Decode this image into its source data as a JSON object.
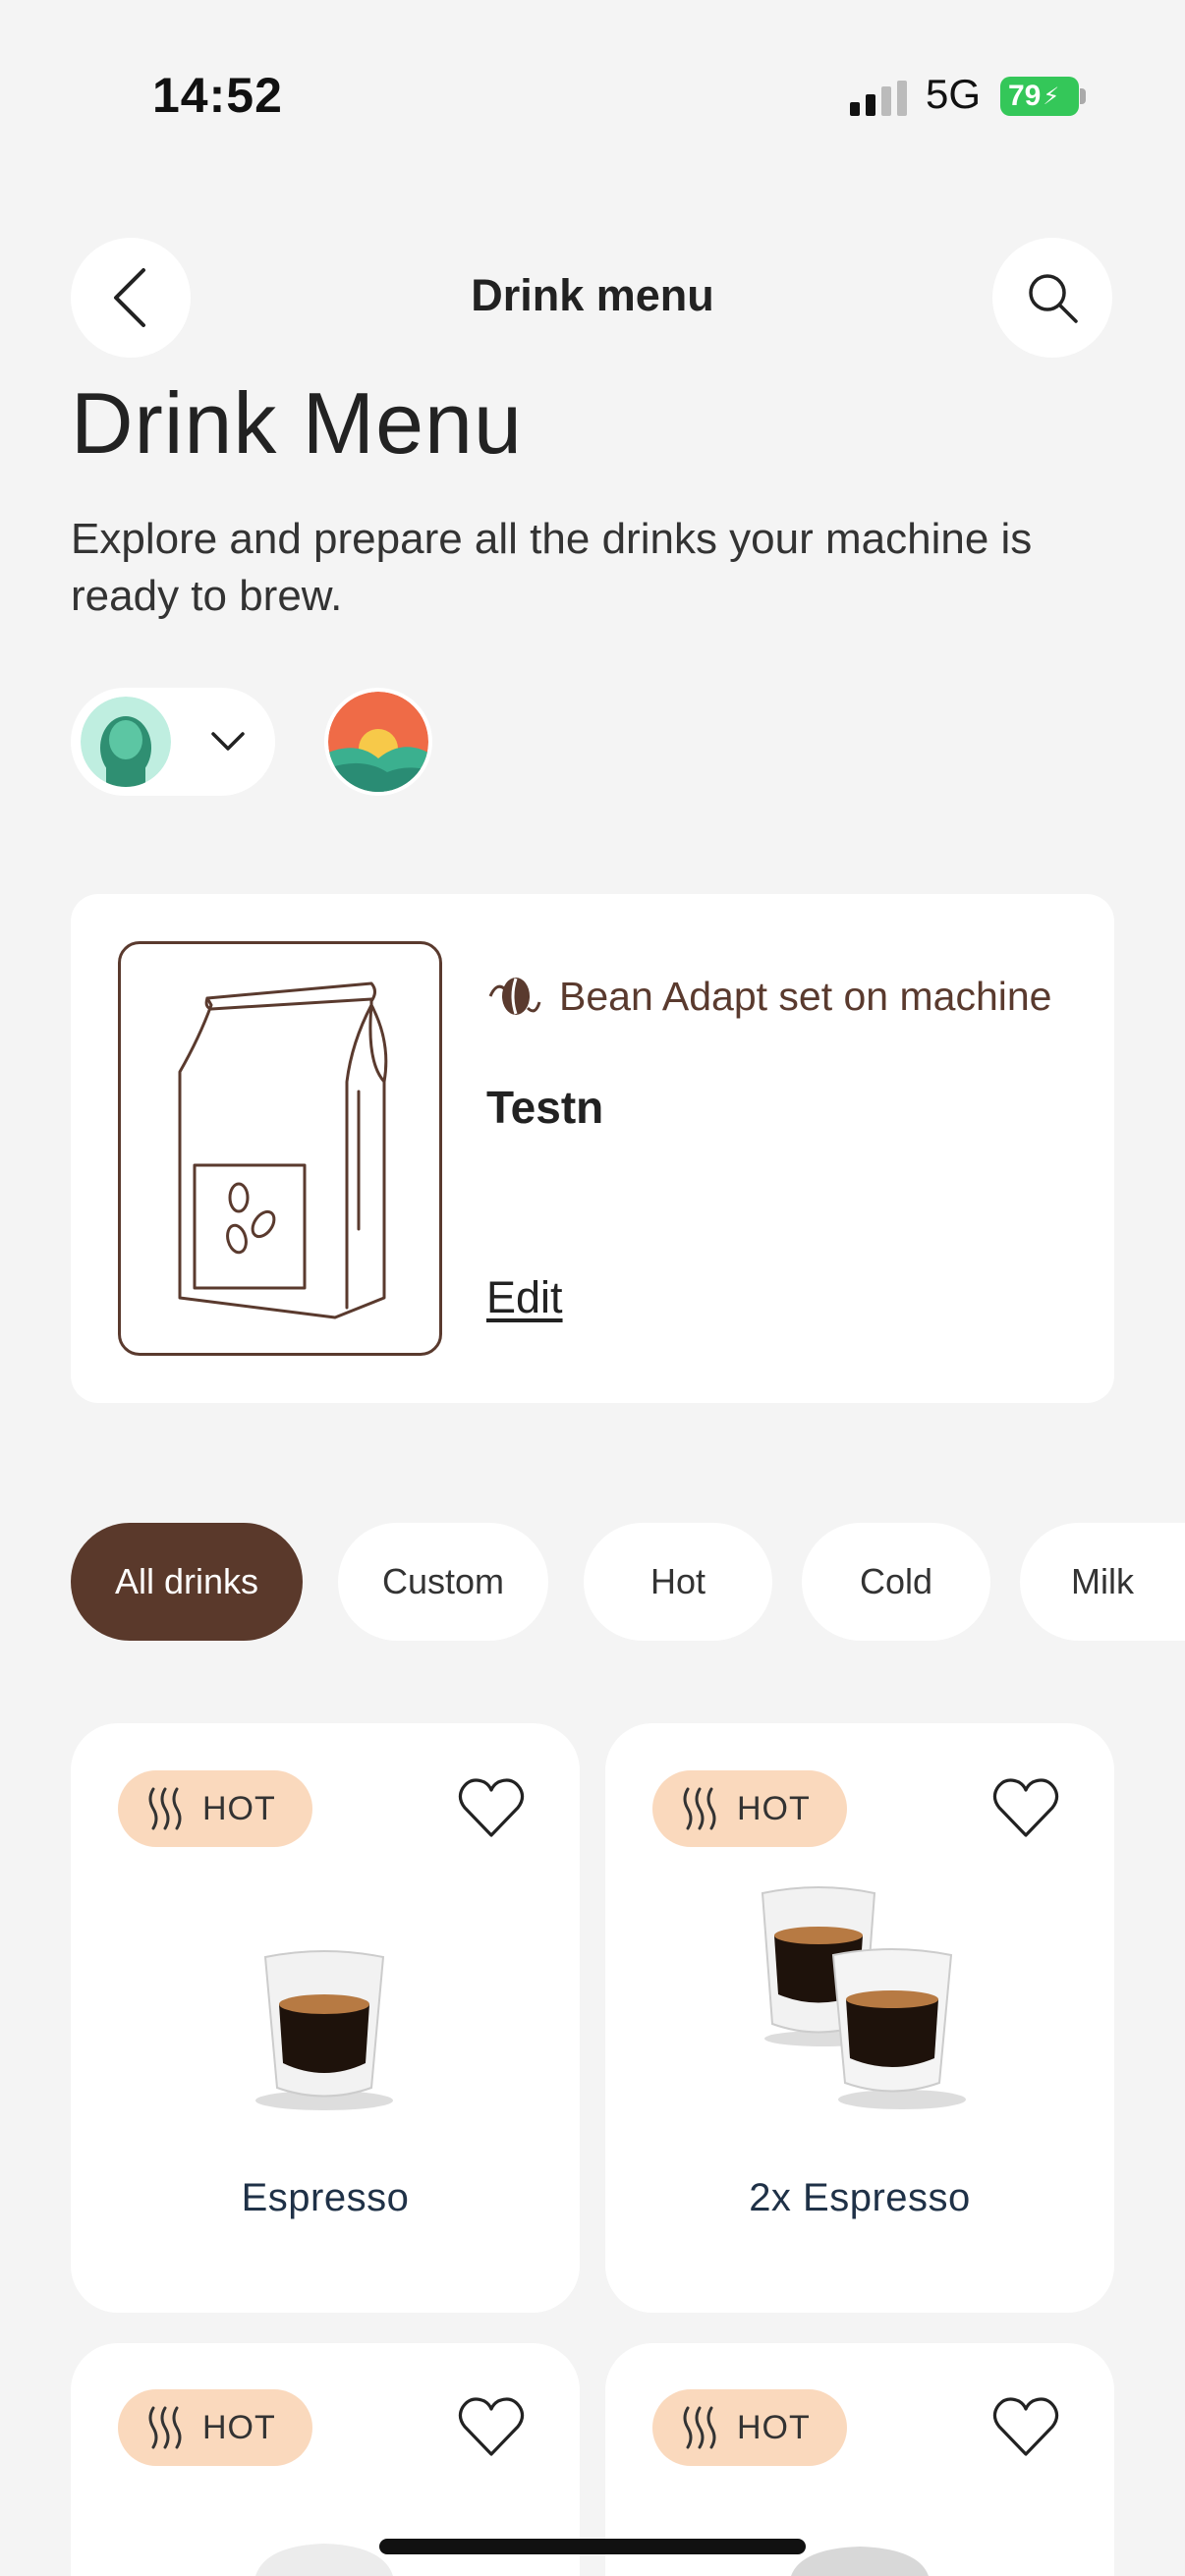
{
  "status_bar": {
    "time": "14:52",
    "network": "5G",
    "battery": "79"
  },
  "nav": {
    "title": "Drink menu",
    "back_icon": "chevron-left-icon",
    "search_icon": "search-icon"
  },
  "page": {
    "heading": "Drink Menu",
    "subtitle": "Explore and prepare all the drinks your machine is ready to brew."
  },
  "bean": {
    "adapt_label": "Bean Adapt set on machine",
    "name": "Testn",
    "edit_label": "Edit"
  },
  "filters": [
    {
      "label": "All drinks",
      "active": true
    },
    {
      "label": "Custom"
    },
    {
      "label": "Hot"
    },
    {
      "label": "Cold"
    },
    {
      "label": "Milk"
    }
  ],
  "drinks": [
    {
      "badge": "HOT",
      "name": "Espresso"
    },
    {
      "badge": "HOT",
      "name": "2x Espresso"
    },
    {
      "badge": "HOT",
      "name": ""
    },
    {
      "badge": "HOT",
      "name": ""
    }
  ],
  "colors": {
    "accent": "#5a392b",
    "hot_badge": "#fad9bd",
    "background": "#f4f4f4"
  }
}
